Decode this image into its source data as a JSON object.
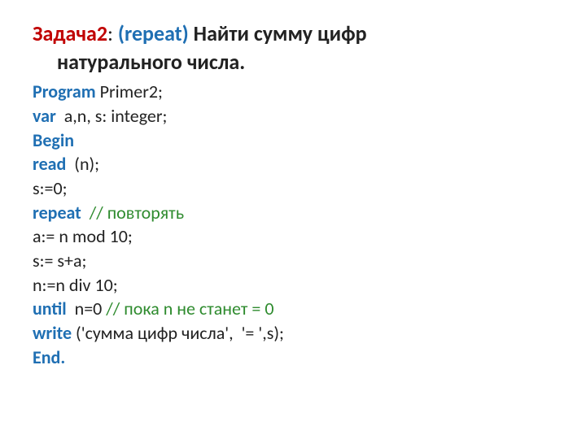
{
  "title": {
    "task": "Задача2",
    "colon": ": ",
    "repeat": "(repeat)",
    "space": " ",
    "rest1": "Найти сумму цифр",
    "rest2": "натурального числа."
  },
  "lines": {
    "l1_kw": "Program",
    "l1_rest": " Primer2;",
    "l2_kw": "var",
    "l2_rest": "  a,n, s: integer;",
    "l3_kw": "Begin",
    "l4_kw": "read",
    "l4_rest": "  (n);",
    "l5": "s:=0;",
    "l6_kw": "repeat",
    "l6_sp": "  ",
    "l6_cm": "// повторять",
    "l7": "a:= n mod 10;",
    "l8": "s:= s+a;",
    "l9": "n:=n div 10;",
    "l10_kw": "until",
    "l10_rest": "  n=0 ",
    "l10_cm": "// пока n не станет = 0",
    "l11_kw": "write",
    "l11_rest": " ('сумма цифр числа',  '= ',s);",
    "l12_kw": "End.",
    "l12_rest": ""
  }
}
